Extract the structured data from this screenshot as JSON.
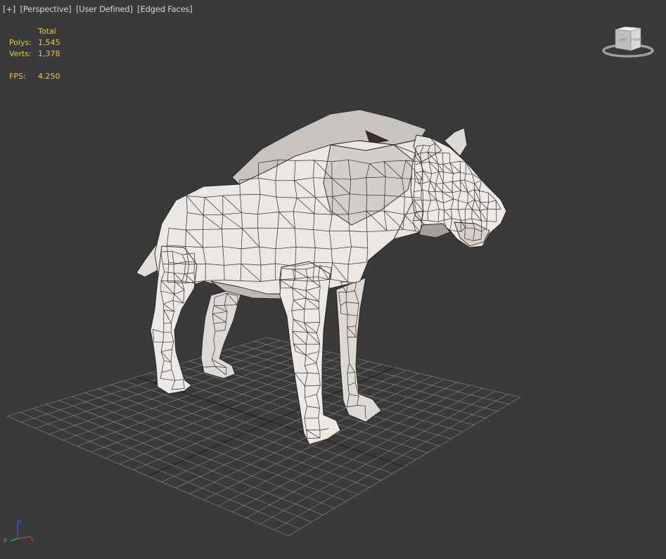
{
  "viewport": {
    "labels": [
      "[+]",
      "[Perspective]",
      "[User Defined]",
      "[Edged Faces]"
    ]
  },
  "stats": {
    "header": "Total",
    "polys_label": "Polys:",
    "polys_value": "1,545",
    "verts_label": "Verts:",
    "verts_value": "1,378",
    "fps_label": "FPS:",
    "fps_value": "4.250"
  },
  "viewcube": {
    "face_left": "LEFT",
    "face_front": "FRONT"
  },
  "axis": {
    "x": "x",
    "y": "y",
    "z": "z"
  },
  "colors": {
    "background": "#3a3a3a",
    "grid": "#8c8c8c",
    "grid_axis": "#1e1e1e",
    "mesh_fill": "#e9e6e3",
    "mesh_shade": "#c9c5c1",
    "mesh_dark": "#9d9892",
    "wire": "#222222",
    "stats_text": "#e6c84a"
  }
}
